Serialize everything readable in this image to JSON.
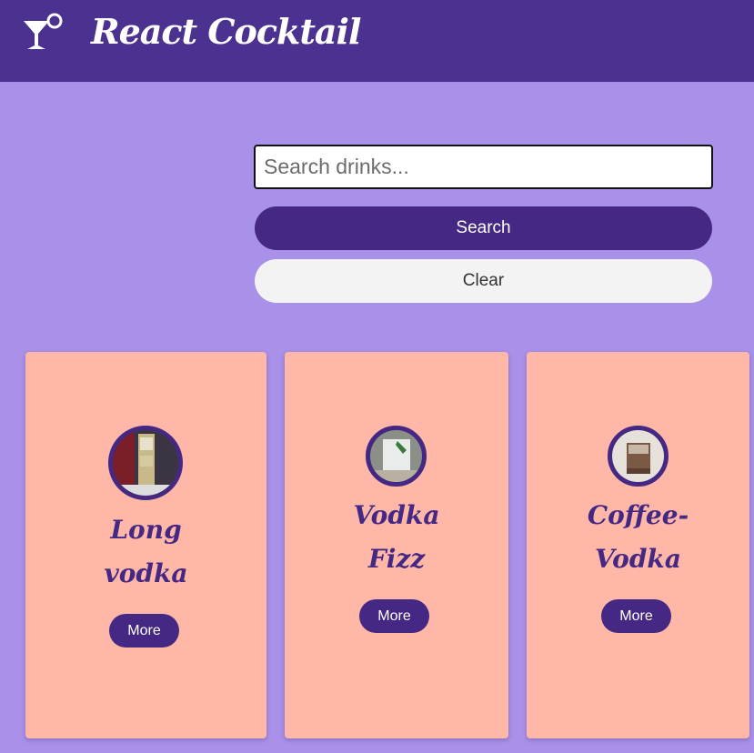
{
  "header": {
    "title": "React Cocktail",
    "logo_icon": "cocktail-glass-icon",
    "background": "#4b3290"
  },
  "search": {
    "placeholder": "Search drinks...",
    "value": "",
    "search_label": "Search",
    "clear_label": "Clear"
  },
  "drinks": [
    {
      "name_line1": "Long",
      "name_line2": "vodka",
      "more_label": "More",
      "image": "long-vodka-photo"
    },
    {
      "name_line1": "Vodka",
      "name_line2": "Fizz",
      "more_label": "More",
      "image": "vodka-fizz-photo"
    },
    {
      "name_line1": "Coffee-",
      "name_line2": "Vodka",
      "more_label": "More",
      "image": "coffee-vodka-photo"
    }
  ],
  "colors": {
    "page_background": "#a990e8",
    "accent": "#452883",
    "card_background": "#ffb8a8"
  }
}
